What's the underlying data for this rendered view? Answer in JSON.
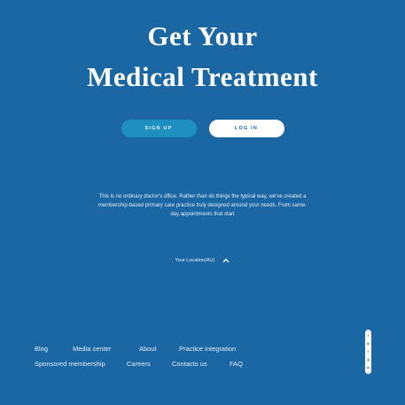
{
  "hero": {
    "title_line1": "Get Your",
    "title_line2": "Medical Treatment"
  },
  "cta": {
    "signup_label": "SIGN UP",
    "login_label": "LOG IN"
  },
  "description": "This is no ordinary doctor's office. Rather than do things the typical way, we've created a membership-based primary care practice truly designed around your needs. From same-day appointments that start",
  "location": {
    "label": "Your Location(AU)",
    "icon": "chevron-up-icon"
  },
  "footer": {
    "row1": [
      "Blog",
      "Media center",
      "About",
      "Practice integration"
    ],
    "row2": [
      "Sponsored membership",
      "Careers",
      "Contacts us",
      "FAQ"
    ]
  },
  "social": {
    "icons": [
      "facebook-icon",
      "linkedin-icon",
      "twitter-icon",
      "instagram-icon",
      "linkedin-icon"
    ],
    "glyphs": [
      "f",
      "in",
      "t",
      "◎",
      "in"
    ]
  },
  "colors": {
    "background": "#1a67a3",
    "signup_button": "#1f8ec0",
    "login_button": "#ffffff"
  }
}
